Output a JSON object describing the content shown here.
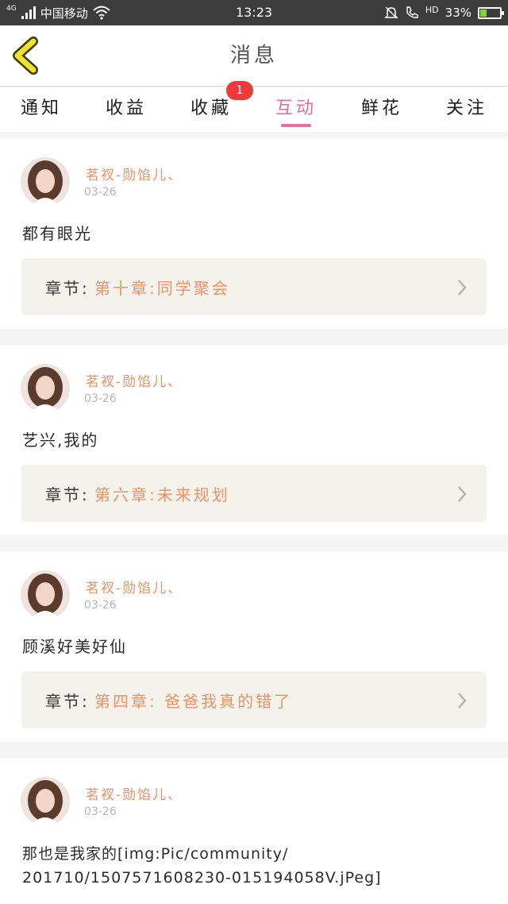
{
  "status_bar": {
    "network": "4G",
    "carrier": "中国移动",
    "time": "13:23",
    "hd": "HD",
    "battery": "33%",
    "battery_level": 0.33
  },
  "header": {
    "back_icon": "chevron-left-icon",
    "title": "消息"
  },
  "tabs": {
    "items": [
      {
        "label": "通知"
      },
      {
        "label": "收益"
      },
      {
        "label": "收藏",
        "badge": "1"
      },
      {
        "label": "互动",
        "active": true
      },
      {
        "label": "鲜花"
      },
      {
        "label": "关注"
      }
    ]
  },
  "messages": [
    {
      "user": "茗衩-勋馅儿、",
      "date": "03-26",
      "comment": "都有眼光",
      "chapter_label": "章节:",
      "chapter_title": "第十章:同学聚会"
    },
    {
      "user": "茗衩-勋馅儿、",
      "date": "03-26",
      "comment": "艺兴,我的",
      "chapter_label": "章节:",
      "chapter_title": "第六章:未来规划"
    },
    {
      "user": "茗衩-勋馅儿、",
      "date": "03-26",
      "comment": "顾溪好美好仙",
      "chapter_label": "章节:",
      "chapter_title": "第四章: 爸爸我真的错了"
    },
    {
      "user": "茗衩-勋馅儿、",
      "date": "03-26",
      "comment_line1": "那也是我家的[img:Pic/community/",
      "comment_line2": "201710/1507571608230-015194058V.jPeg]"
    }
  ],
  "colors": {
    "accent_pink": "#e96e9a",
    "username_orange": "#ee9266",
    "badge_red": "#ee3a3a",
    "chapter_bg": "#f3f3ec"
  }
}
